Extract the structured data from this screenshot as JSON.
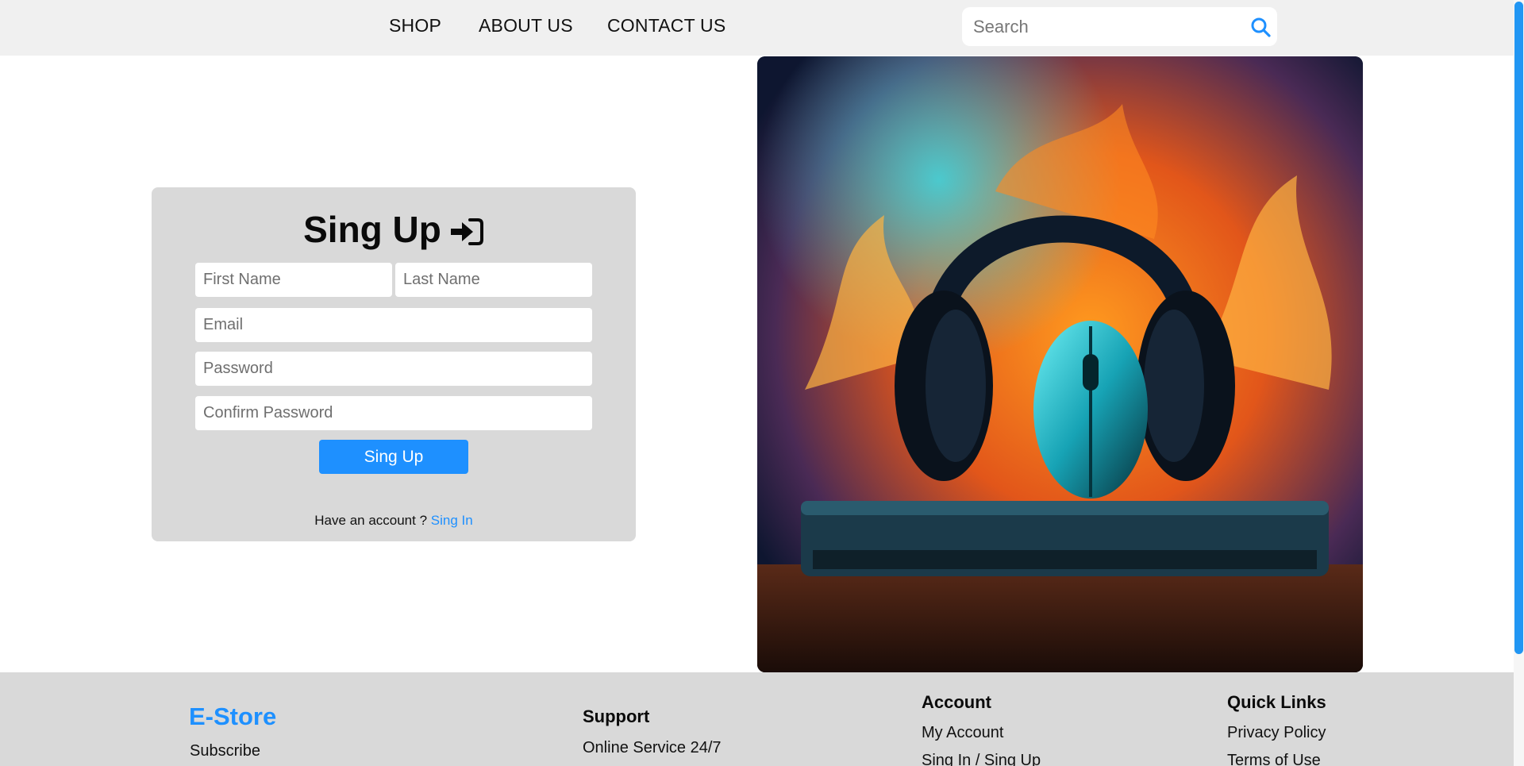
{
  "nav": {
    "links": [
      "SHOP",
      "ABOUT US",
      "CONTACT US"
    ],
    "search_placeholder": "Search",
    "search_icon": "search-icon",
    "search_icon_color": "#1e90ff"
  },
  "signup": {
    "title": "Sing Up",
    "title_icon": "sign-in-icon",
    "first_name_placeholder": "First Name",
    "last_name_placeholder": "Last Name",
    "email_placeholder": "Email",
    "password_placeholder": "Password",
    "confirm_password_placeholder": "Confirm Password",
    "submit_label": "Sing Up",
    "account_prompt": "Have an account ?",
    "signin_link": "Sing In"
  },
  "hero": {
    "image_icon": "headphones-mouse-fire-image"
  },
  "footer": {
    "brand": "E-Store",
    "brand_links": [
      "Subscribe"
    ],
    "support": {
      "title": "Support",
      "items": [
        "Online Service 24/7"
      ]
    },
    "account": {
      "title": "Account",
      "items": [
        "My Account",
        "Sing In / Sing Up"
      ]
    },
    "quick_links": {
      "title": "Quick Links",
      "items": [
        "Privacy Policy",
        "Terms of Use"
      ]
    }
  },
  "colors": {
    "accent": "#1e90ff",
    "topbar_bg": "#f0f0f0",
    "card_bg": "#d9d9d9",
    "footer_bg": "#d9d9d9"
  }
}
